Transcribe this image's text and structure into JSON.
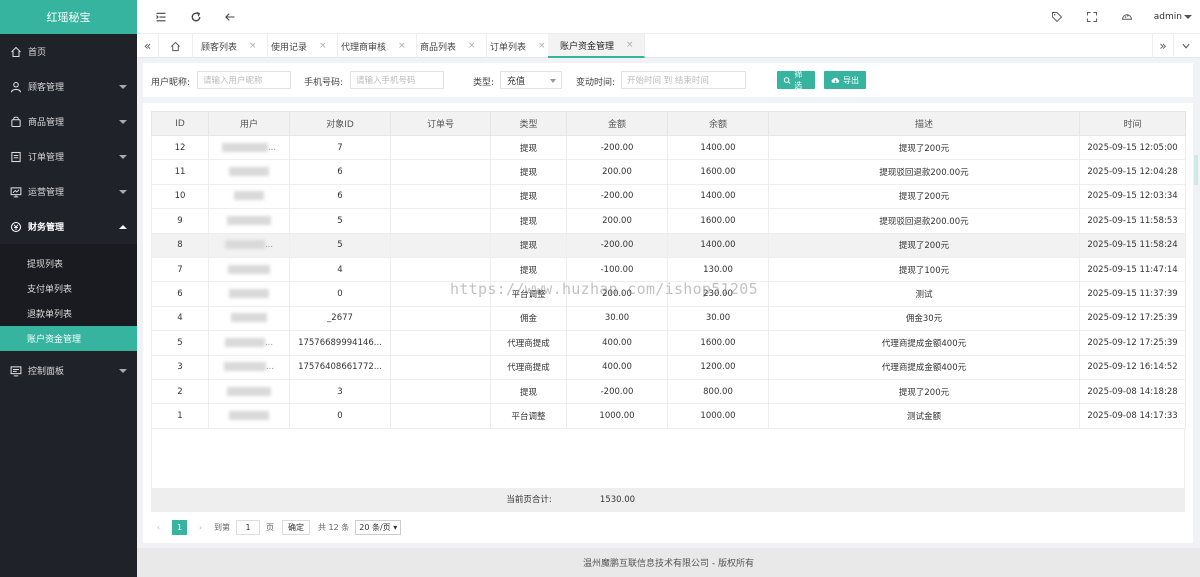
{
  "app": {
    "title": "红瑶秘宝"
  },
  "sidebar": {
    "items": [
      {
        "label": "首页",
        "icon": "home-icon"
      },
      {
        "label": "顾客管理",
        "icon": "user-icon"
      },
      {
        "label": "商品管理",
        "icon": "bag-icon"
      },
      {
        "label": "订单管理",
        "icon": "order-icon"
      },
      {
        "label": "运营管理",
        "icon": "monitor-icon"
      },
      {
        "label": "财务管理",
        "icon": "finance-icon"
      },
      {
        "label": "控制面板",
        "icon": "panel-icon"
      }
    ],
    "finance_sub": [
      "提现列表",
      "支付单列表",
      "退款单列表",
      "账户资金管理"
    ]
  },
  "header": {
    "user": "admin"
  },
  "tabs": [
    "顾客列表",
    "使用记录",
    "代理商审核",
    "商品列表",
    "订单列表",
    "账户资金管理"
  ],
  "filter": {
    "nickname_label": "用户昵称:",
    "nickname_placeholder": "请输入用户昵称",
    "phone_label": "手机号码:",
    "phone_placeholder": "请输入手机号码",
    "type_label": "类型:",
    "type_value": "充值",
    "time_label": "变动时间:",
    "time_placeholder": "开始时间 到 结束时间",
    "search_label": "筛选",
    "export_label": "导出"
  },
  "table": {
    "columns": [
      "ID",
      "用户",
      "对象ID",
      "订单号",
      "类型",
      "金额",
      "余额",
      "描述",
      "时间"
    ],
    "rows": [
      {
        "id": "12",
        "user": "...",
        "obj": "7",
        "order": "",
        "type": "提现",
        "amount": "-200.00",
        "balance": "1400.00",
        "desc": "提现了200元",
        "time": "2025-09-15 12:05:00"
      },
      {
        "id": "11",
        "user": "",
        "obj": "6",
        "order": "",
        "type": "提现",
        "amount": "200.00",
        "balance": "1600.00",
        "desc": "提现驳回退款200.00元",
        "time": "2025-09-15 12:04:28"
      },
      {
        "id": "10",
        "user": "",
        "obj": "6",
        "order": "",
        "type": "提现",
        "amount": "-200.00",
        "balance": "1400.00",
        "desc": "提现了200元",
        "time": "2025-09-15 12:03:34"
      },
      {
        "id": "9",
        "user": "",
        "obj": "5",
        "order": "",
        "type": "提现",
        "amount": "200.00",
        "balance": "1600.00",
        "desc": "提现驳回退款200.00元",
        "time": "2025-09-15 11:58:53"
      },
      {
        "id": "8",
        "user": "...",
        "obj": "5",
        "order": "",
        "type": "提现",
        "amount": "-200.00",
        "balance": "1400.00",
        "desc": "提现了200元",
        "time": "2025-09-15 11:58:24"
      },
      {
        "id": "7",
        "user": "",
        "obj": "4",
        "order": "",
        "type": "提现",
        "amount": "-100.00",
        "balance": "130.00",
        "desc": "提现了100元",
        "time": "2025-09-15 11:47:14"
      },
      {
        "id": "6",
        "user": "",
        "obj": "0",
        "order": "",
        "type": "平台调整",
        "amount": "200.00",
        "balance": "230.00",
        "desc": "测试",
        "time": "2025-09-15 11:37:39"
      },
      {
        "id": "4",
        "user": "",
        "obj": "_2677",
        "order": "",
        "type": "佣金",
        "amount": "30.00",
        "balance": "30.00",
        "desc": "佣金30元",
        "time": "2025-09-12 17:25:39"
      },
      {
        "id": "5",
        "user": "...",
        "obj": "17576689994146...",
        "order": "",
        "type": "代理商提成",
        "amount": "400.00",
        "balance": "1600.00",
        "desc": "代理商提成金额400元",
        "time": "2025-09-12 17:25:39"
      },
      {
        "id": "3",
        "user": "...",
        "obj": "17576408661772...",
        "order": "",
        "type": "代理商提成",
        "amount": "400.00",
        "balance": "1200.00",
        "desc": "代理商提成金额400元",
        "time": "2025-09-12 16:14:52"
      },
      {
        "id": "2",
        "user": "",
        "obj": "3",
        "order": "",
        "type": "提现",
        "amount": "-200.00",
        "balance": "800.00",
        "desc": "提现了200元",
        "time": "2025-09-08 14:18:28"
      },
      {
        "id": "1",
        "user": "",
        "obj": "0",
        "order": "",
        "type": "平台调整",
        "amount": "1000.00",
        "balance": "1000.00",
        "desc": "测试金额",
        "time": "2025-09-08 14:17:33"
      }
    ],
    "highlighted_row": 4,
    "sum_label": "当前页合计:",
    "sum_value": "1530.00"
  },
  "pager": {
    "current": "1",
    "goto_prefix": "到第",
    "goto_value": "1",
    "goto_suffix": "页",
    "confirm": "确定",
    "total": "共 12 条",
    "per_page": "20 条/页"
  },
  "watermark": "https://www.huzhan.com/ishop51205",
  "footer": "温州魔鹏互联信息技术有限公司 - 版权所有",
  "colors": {
    "accent": "#36b49f",
    "sidebar": "#20222a"
  }
}
